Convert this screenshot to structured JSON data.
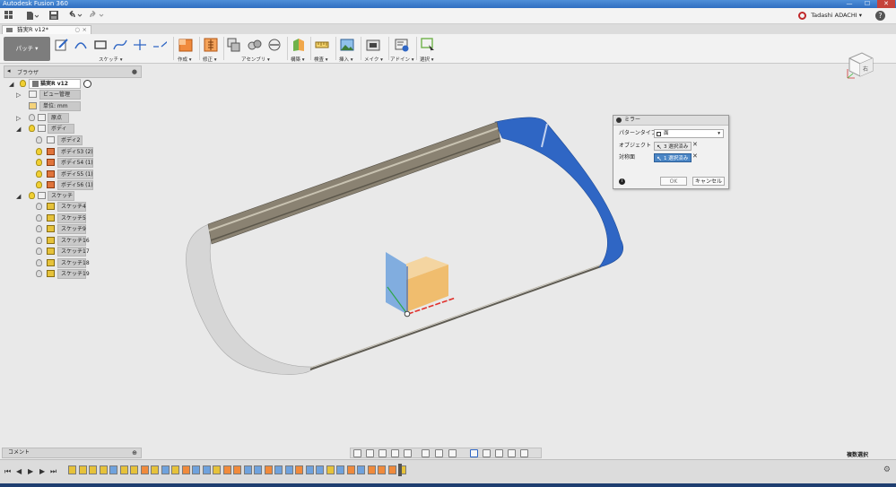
{
  "app": {
    "title": "Autodesk Fusion 360",
    "user": "Tadashi ADACHI",
    "help": "?",
    "win_min": "—",
    "win_max": "☐",
    "win_close": "✕"
  },
  "document_tab": {
    "label": "猫実R v12*"
  },
  "workspace": {
    "label": "パッチ ▾"
  },
  "ribbon": {
    "groups": [
      "スケッチ ▾",
      "作成 ▾",
      "修正 ▾",
      "アセンブリ ▾",
      "構築 ▾",
      "検査 ▾",
      "挿入 ▾",
      "メイク ▾",
      "アドイン ▾",
      "選択 ▾"
    ]
  },
  "viewcube": {
    "face": "右"
  },
  "browser": {
    "title": "ブラウザ",
    "root": "猫実R v12",
    "items": [
      "ビュー管理",
      "単位: mm",
      "原点",
      "ボディ",
      "ボディ2",
      "ボディ53 (2)",
      "ボディ54 (1)",
      "ボディ55 (1)",
      "ボディ56 (1)",
      "スケッチ",
      "スケッチ4",
      "スケッチ5",
      "スケッチ9",
      "スケッチ16",
      "スケッチ17",
      "スケッチ18",
      "スケッチ19"
    ]
  },
  "mirror_dialog": {
    "title": "ミラー",
    "pattern_type_label": "パターンタイプ",
    "pattern_type_value": "面",
    "object_label": "オブジェクト",
    "object_value": "3 選択済み",
    "plane_label": "対称面",
    "plane_value": "1 選択済み",
    "ok": "OK",
    "cancel": "キャンセル"
  },
  "comment_panel": {
    "label": "コメント"
  },
  "status": {
    "selection_mode": "複数選択"
  },
  "colors": {
    "accent_blue": "#2f66c4",
    "body_gray": "#d9d9d9",
    "tube": "#8a8272",
    "plane_orange": "#f1b861",
    "plane_blue": "#6fa2dd"
  }
}
